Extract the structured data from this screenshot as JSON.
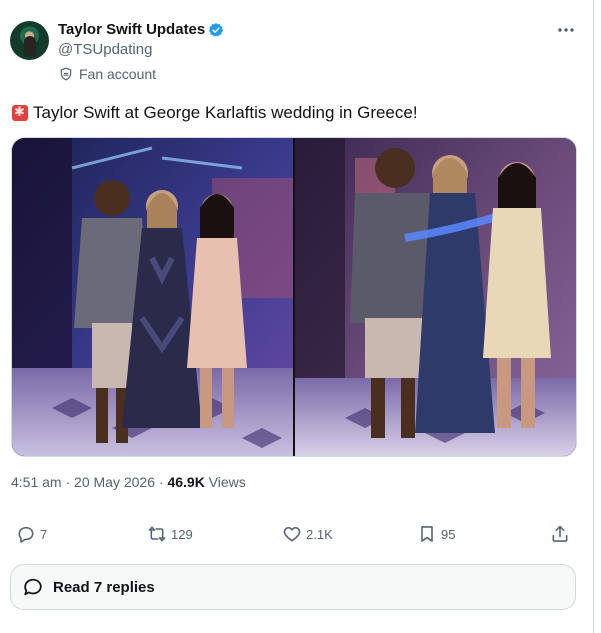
{
  "author": {
    "display_name": "Taylor Swift Updates",
    "handle": "@TSUpdating",
    "label": "Fan account",
    "verified": true
  },
  "tweet": {
    "emoji": "siren-emoji",
    "text": "Taylor Swift at George Karlaftis wedding in Greece!"
  },
  "media": [
    {
      "alt": "photo-1"
    },
    {
      "alt": "photo-2"
    }
  ],
  "meta": {
    "time": "4:51 am",
    "date": "20 May 2026",
    "views_count": "46.9K",
    "views_label": "Views"
  },
  "actions": {
    "replies": "7",
    "reposts": "129",
    "likes": "2.1K",
    "bookmarks": "95"
  },
  "read_replies_label": "Read 7 replies",
  "colors": {
    "verified": "#1d9bf0",
    "secondary_text": "#536471",
    "primary_text": "#0f1419",
    "border": "#cfd9de"
  },
  "icons": [
    "verified-badge-icon",
    "fan-shield-icon",
    "more-icon",
    "reply-icon",
    "repost-icon",
    "like-icon",
    "bookmark-icon",
    "share-icon",
    "speech-bubble-icon"
  ]
}
